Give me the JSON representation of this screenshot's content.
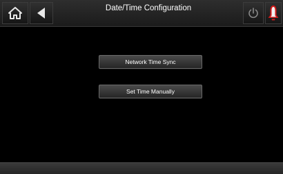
{
  "header": {
    "title": "Date/Time Configuration",
    "home_icon": "home-icon",
    "back_icon": "back-arrow-icon",
    "power_icon": "power-icon",
    "alarm_icon": "alarm-bell-icon"
  },
  "menu": {
    "network_time_sync_label": "Network Time Sync",
    "set_time_manually_label": "Set Time Manually"
  },
  "colors": {
    "background": "#000000",
    "bar": "#222222",
    "alarm": "#d11a1a"
  }
}
